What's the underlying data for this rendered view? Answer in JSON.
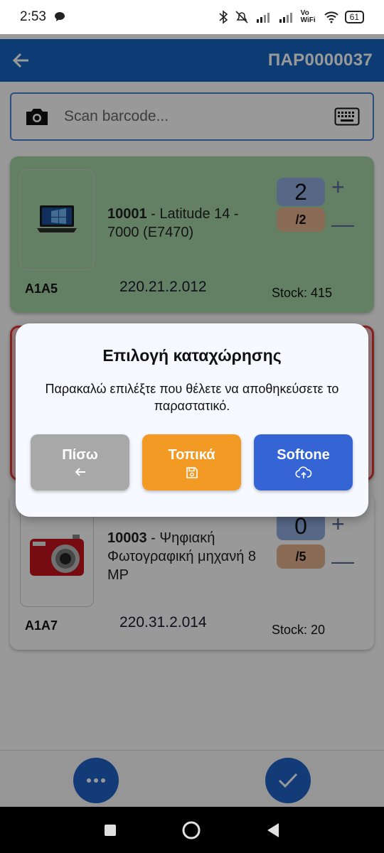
{
  "status_bar": {
    "time": "2:53",
    "network": "Vo WiFi",
    "battery": "61"
  },
  "app_bar": {
    "title": "ΠΑΡ0000037"
  },
  "search": {
    "placeholder": "Scan barcode..."
  },
  "items": [
    {
      "code": "10001",
      "name": " - Latitude 14 - 7000 (E7470)",
      "quantity": "2",
      "denominator": "/2",
      "location": "A1A5",
      "barcode": "220.21.2.012",
      "stock": "Stock: 415",
      "thumbnail": "laptop-icon"
    },
    {
      "code": "10003",
      "name": " - Ψηφιακή Φωτογραφική μηχανή 8 MP",
      "quantity": "0",
      "denominator": "/5",
      "location": "A1A7",
      "barcode": "220.31.2.014",
      "stock": "Stock: 20",
      "thumbnail": "camera-icon"
    }
  ],
  "dialog": {
    "title": "Επιλογή καταχώρησης",
    "message": "Παρακαλώ επιλέξτε που θέλετε να αποθηκεύσετε το παραστατικό.",
    "buttons": {
      "back": "Πίσω",
      "local": "Τοπικά",
      "softone": "Softone"
    }
  },
  "colors": {
    "primary": "#1565c0",
    "card_complete": "#a5d6a7",
    "card_error": "#ffcdd2",
    "back_button": "#a8a8a8",
    "local_button": "#f39a24",
    "softone_button": "#3565d4"
  }
}
